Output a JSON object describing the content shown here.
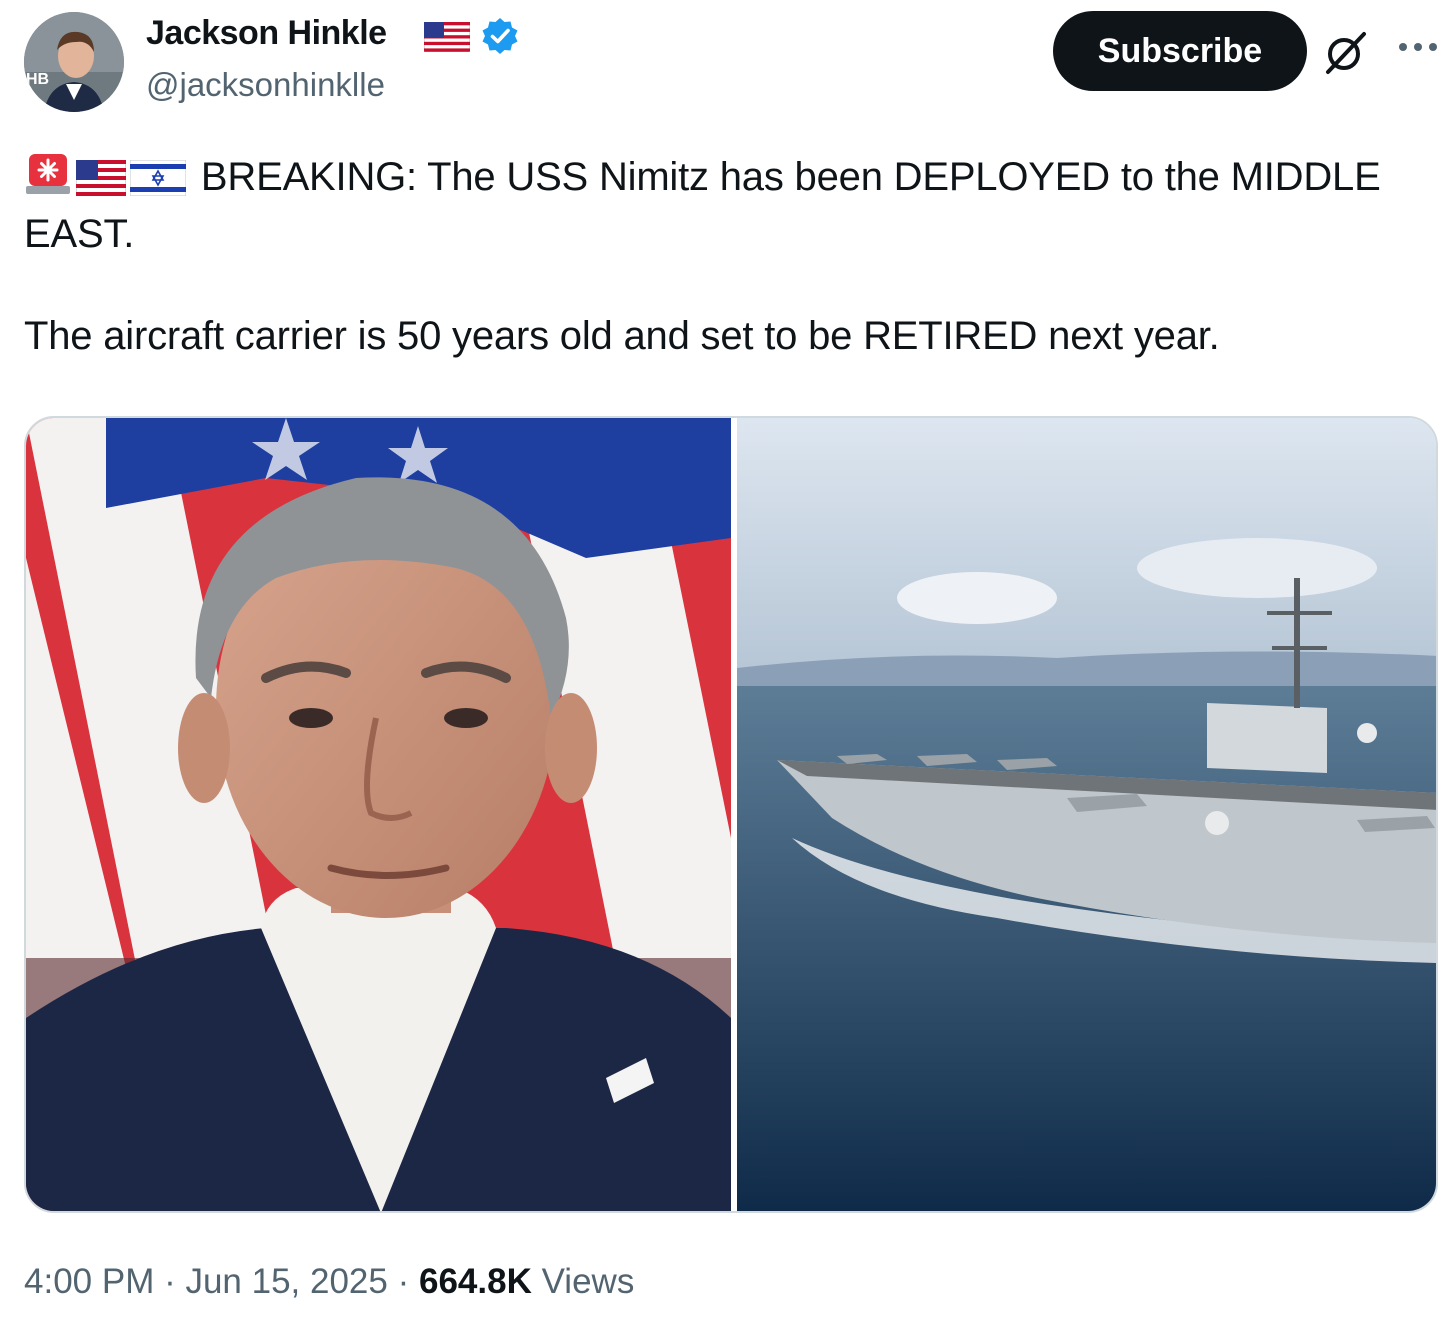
{
  "author": {
    "name": "Jackson Hinkle",
    "handle": "@jacksonhinklle",
    "verified": true,
    "name_flag_icon": "us-flag-icon",
    "avatar_icon": "avatar",
    "avatar_badge_text": "HB"
  },
  "actions": {
    "subscribe_label": "Subscribe",
    "grok_icon": "grok-icon",
    "more_icon": "more-icon"
  },
  "tweet": {
    "emojis": [
      "siren-icon",
      "us-flag-icon",
      "israel-flag-icon"
    ],
    "line1": "BREAKING: The USS Nimitz has been DEPLOYED to the MIDDLE EAST.",
    "line2": "The aircraft carrier is 50 years old and set to be RETIRED next year."
  },
  "media": {
    "image_1": "portrait-photo",
    "image_2": "aircraft-carrier-photo"
  },
  "meta": {
    "time": "4:00 PM",
    "separator": " · ",
    "date": "Jun 15, 2025",
    "views_count": "664.8K",
    "views_label": "Views"
  },
  "colors": {
    "text": "#0f1419",
    "secondary": "#536471",
    "verified_blue": "#1d9bf0",
    "button_bg": "#0f1419",
    "border": "#cfd9de"
  }
}
